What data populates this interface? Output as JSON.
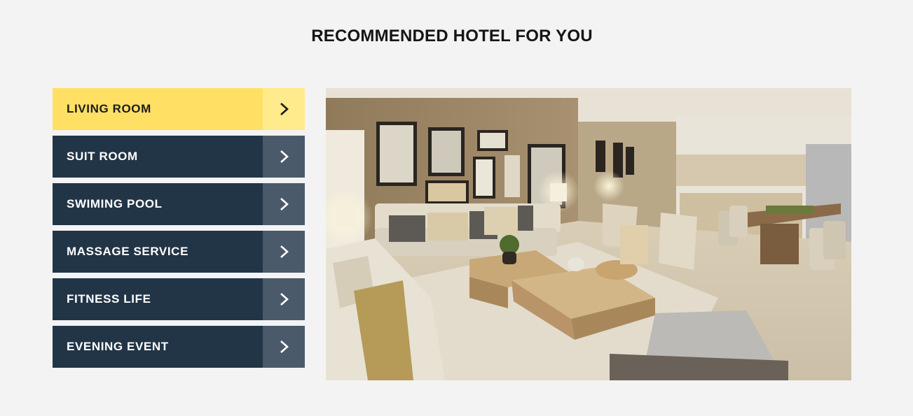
{
  "section": {
    "title": "RECOMMENDED HOTEL FOR YOU"
  },
  "tabs": [
    {
      "label": "LIVING ROOM",
      "active": true
    },
    {
      "label": "SUIT ROOM",
      "active": false
    },
    {
      "label": "SWIMING POOL",
      "active": false
    },
    {
      "label": "MASSAGE SERVICE",
      "active": false
    },
    {
      "label": "FITNESS LIFE",
      "active": false
    },
    {
      "label": "EVENING EVENT",
      "active": false
    }
  ],
  "icons": {
    "tab_arrow": "chevron-right-icon"
  },
  "colors": {
    "active_tab": "#ffe065",
    "active_tab_arrow": "#ffea8c",
    "inactive_tab": "#223547",
    "inactive_tab_arrow": "#4a5a6b",
    "page_background": "#f3f3f3"
  }
}
